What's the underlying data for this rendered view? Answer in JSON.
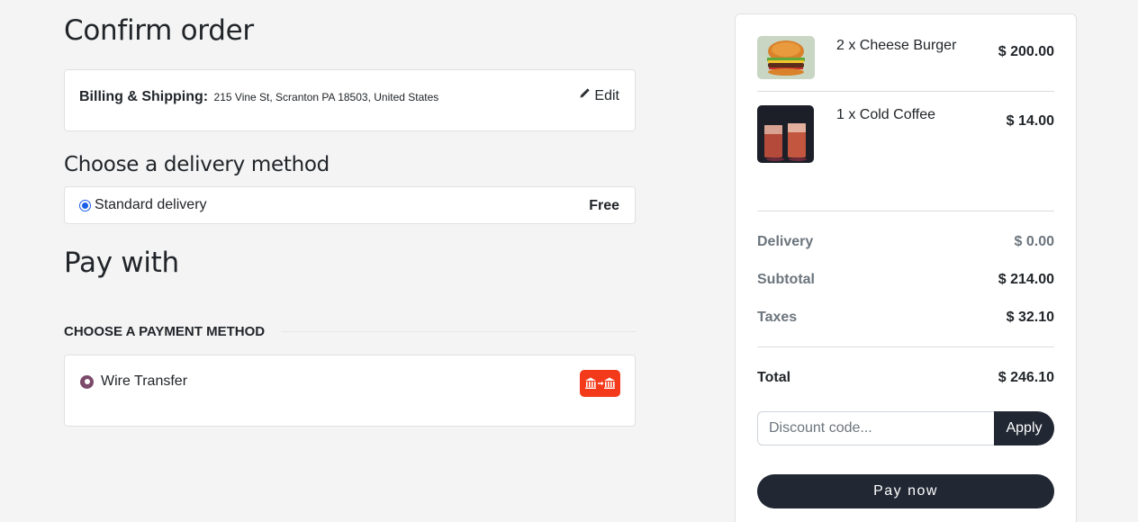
{
  "page": {
    "title": "Confirm order",
    "billing": {
      "label": "Billing & Shipping:",
      "address": "215 Vine St, Scranton PA 18503, United States",
      "edit_label": "Edit"
    },
    "delivery": {
      "heading": "Choose a delivery method",
      "option_label": "Standard delivery",
      "option_price": "Free"
    },
    "pay": {
      "heading": "Pay with",
      "method_header": "Choose a payment method",
      "method_label": "Wire Transfer",
      "method_icon": "bank-transfer-icon"
    }
  },
  "summary": {
    "items": [
      {
        "qty_name": "2 x Cheese Burger",
        "price": "$ 200.00",
        "image": "cheese-burger"
      },
      {
        "qty_name": "1 x Cold Coffee",
        "price": "$ 14.00",
        "image": "cold-coffee"
      }
    ],
    "delivery_label": "Delivery",
    "delivery_value": "$ 0.00",
    "subtotal_label": "Subtotal",
    "subtotal_value": "$ 214.00",
    "taxes_label": "Taxes",
    "taxes_value": "$ 32.10",
    "total_label": "Total",
    "total_value": "$ 246.10",
    "discount_placeholder": "Discount code...",
    "apply_label": "Apply",
    "pay_now_label": "Pay now"
  },
  "colors": {
    "background": "#f4f4f4",
    "dark_button": "#212733",
    "radio_selected": "#1a5ee8",
    "payment_radio": "#7b4a6b",
    "wire_icon_bg": "#f33a1a"
  }
}
